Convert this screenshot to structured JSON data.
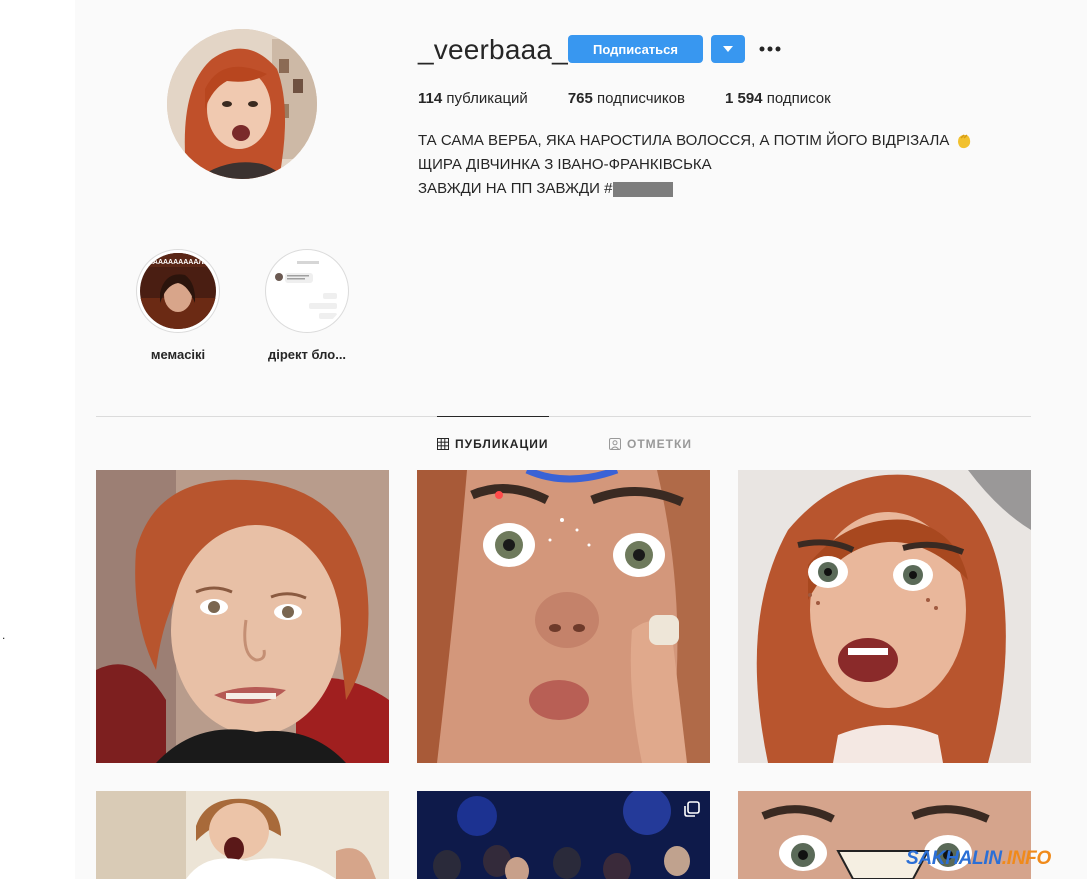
{
  "profile": {
    "username": "_veerbaaa_",
    "follow_label": "Подписаться",
    "stats": [
      {
        "value": "114",
        "label": "публикаций"
      },
      {
        "value": "765",
        "label": "подписчиков"
      },
      {
        "value": "1 594",
        "label": "подписок"
      }
    ],
    "bio": [
      "ТА САМА ВЕРБА, ЯКА НАРОСТИЛА ВОЛОССЯ, А ПОТІМ ЙОГО ВІДРІЗАЛА",
      "ЩИРА ДІВЧИНКА З ІВАНО-ФРАНКІВСЬКА",
      "ЗАВЖДИ НА ПП ЗАВЖДИ #"
    ]
  },
  "highlights": [
    {
      "label": "мемасікі",
      "overlay_text": "АААААААААААЛЛЛ"
    },
    {
      "label": "дірект бло..."
    }
  ],
  "tabs": {
    "posts": "ПУБЛИКАЦИИ",
    "tagged": "ОТМЕТКИ"
  },
  "watermark": {
    "part1": "SAKHALIN",
    "part2": ".INFO"
  },
  "colors": {
    "accent": "#3897f0",
    "text": "#262626",
    "muted": "#999999",
    "border": "#dbdbdb",
    "watermark_blue": "#2b6fd6",
    "watermark_orange": "#f08a1a"
  },
  "icons": {
    "dropdown": "triangle-down-icon",
    "more": "ellipsis-icon",
    "posts_tab": "grid-icon",
    "tagged_tab": "tagged-person-icon",
    "multi_post": "carousel-icon"
  }
}
